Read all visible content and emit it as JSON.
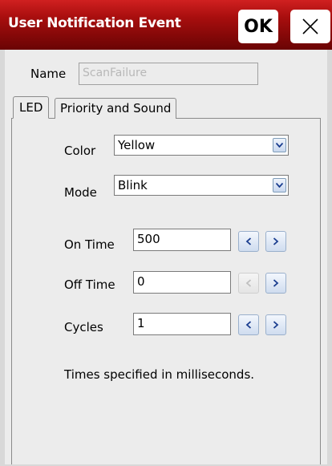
{
  "window": {
    "title": "User Notification Event",
    "ok_label": "OK"
  },
  "name": {
    "label": "Name",
    "value": "ScanFailure"
  },
  "tabs": [
    {
      "label": "LED",
      "active": true
    },
    {
      "label": "Priority and Sound",
      "active": false
    }
  ],
  "led": {
    "color_label": "Color",
    "color_value": "Yellow",
    "mode_label": "Mode",
    "mode_value": "Blink",
    "on_time_label": "On Time",
    "on_time_value": "500",
    "off_time_label": "Off Time",
    "off_time_value": "0",
    "cycles_label": "Cycles",
    "cycles_value": "1",
    "hint": "Times specified in milliseconds."
  },
  "icons": {
    "close": "close-icon",
    "dropdown": "chevron-down-icon",
    "decrement": "chevron-left-icon",
    "increment": "chevron-right-icon"
  },
  "colors": {
    "title_bar": "#a80e0e",
    "stepper_arrow": "#1a3d8f"
  }
}
